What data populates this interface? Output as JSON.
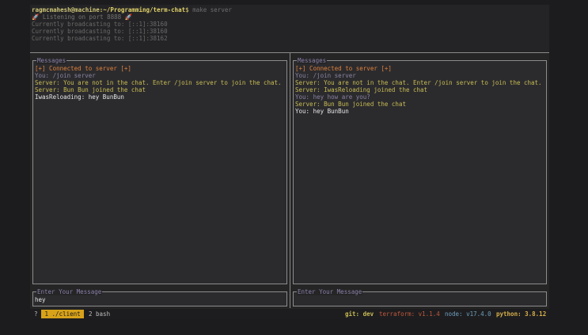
{
  "top": {
    "prompt_user": "ragmcmahesh@machine",
    "prompt_path": ":~/Programming/term-chat",
    "prompt_symbol": "$",
    "command": " make server",
    "listening": "🚀 Listening on port 8888 🚀",
    "broadcasts": [
      "Currently broadcasting to: [::1]:38160",
      "Currently broadcasting to: [::1]:38160",
      "Currently broadcasting to: [::1]:38162"
    ]
  },
  "left_pane": {
    "messages_label": "Messages",
    "messages": [
      {
        "text": "[+] Connected to server [+]",
        "color": "orange"
      },
      {
        "text": "You: /join server",
        "color": "gray"
      },
      {
        "text": "Server: You are not in the chat. Enter /join server to join the chat.",
        "color": "yellow"
      },
      {
        "text": "Server: Bun Bun joined the chat",
        "color": "yellow"
      },
      {
        "text": "IwasReloading: hey BunBun",
        "color": "white"
      }
    ],
    "input_label": "Enter Your Message",
    "input_value": "hey"
  },
  "right_pane": {
    "messages_label": "Messages",
    "messages": [
      {
        "text": "[+] Connected to server [+]",
        "color": "orange"
      },
      {
        "text": "You: /join server",
        "color": "gray"
      },
      {
        "text": "Server: You are not in the chat. Enter /join server to join the chat.",
        "color": "yellow"
      },
      {
        "text": "Server: IwasReloading joined the chat",
        "color": "yellow"
      },
      {
        "text": "You: hey how are you?",
        "color": "gray"
      },
      {
        "text": "Server: Bun Bun joined the chat",
        "color": "yellow"
      },
      {
        "text": "You: hey BunBun",
        "color": "white"
      }
    ],
    "input_label": "Enter Your Message",
    "input_value": ""
  },
  "status_bar": {
    "question": "?",
    "window_1": " 1 ./client ",
    "window_2": "2 bash",
    "git": "git: dev",
    "terraform": "terraform: v1.1.4",
    "node": "node: v17.4.0",
    "python": "python: 3.8.12"
  },
  "colors": {
    "orange": "#e0803a",
    "gray": "#8a82a0",
    "yellow": "#c9bc53",
    "white": "#e6e6e6",
    "active_window_bg": "#d7a21a"
  }
}
